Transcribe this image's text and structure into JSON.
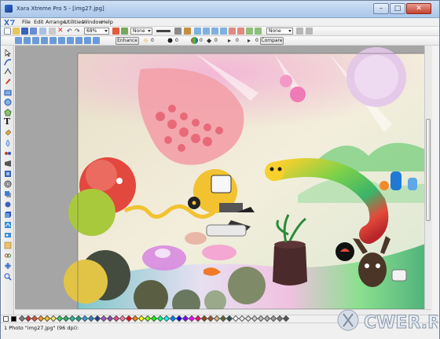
{
  "window": {
    "title": "Xara Xtreme Pro 5 - [img27.jpg]",
    "min_glyph": "–",
    "max_glyph": "□",
    "close_glyph": "✕"
  },
  "menu": [
    "File",
    "Edit",
    "Arrange",
    "Utilities",
    "Window",
    "Help"
  ],
  "toolbar1": {
    "zoom_value": "68%",
    "fill_value": "None",
    "quality_value": "None"
  },
  "toolbar2": {
    "enhance_label": "Enhance",
    "values": [
      "0",
      "0",
      "0",
      "0",
      "0",
      "0"
    ],
    "compare_label": "Compare"
  },
  "status": {
    "text": "1 Photo \"img27.jpg\" (96 dpi):"
  },
  "watermark": {
    "text": "CWER.RU"
  },
  "colors": {
    "accent": "#3c7fd8",
    "close": "#c4422f"
  }
}
